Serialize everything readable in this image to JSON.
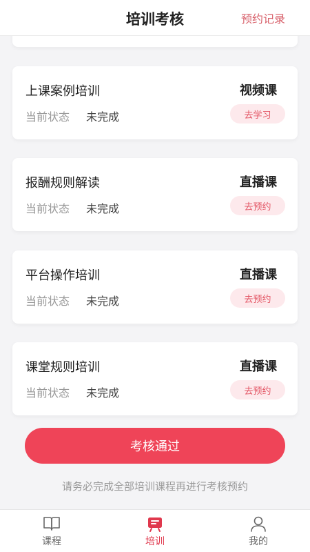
{
  "header": {
    "title": "培训考核",
    "record_link": "预约记录"
  },
  "courses": [
    {
      "name": "上课案例培训",
      "type": "视频课",
      "status_label": "当前状态",
      "status": "未完成",
      "action": "去学习"
    },
    {
      "name": "报酬规则解读",
      "type": "直播课",
      "status_label": "当前状态",
      "status": "未完成",
      "action": "去预约"
    },
    {
      "name": "平台操作培训",
      "type": "直播课",
      "status_label": "当前状态",
      "status": "未完成",
      "action": "去预约"
    },
    {
      "name": "课堂规则培训",
      "type": "直播课",
      "status_label": "当前状态",
      "status": "未完成",
      "action": "去预约"
    }
  ],
  "pass_button": "考核通过",
  "notice": "请务必完成全部培训课程再进行考核预约",
  "tabbar": {
    "tabs": [
      {
        "label": "课程",
        "icon": "book-icon"
      },
      {
        "label": "培训",
        "icon": "training-board-icon",
        "active": true
      },
      {
        "label": "我的",
        "icon": "user-icon"
      }
    ]
  },
  "colors": {
    "accent": "#ef4458",
    "accent_light": "#fde9ec",
    "link": "#d8616b"
  }
}
